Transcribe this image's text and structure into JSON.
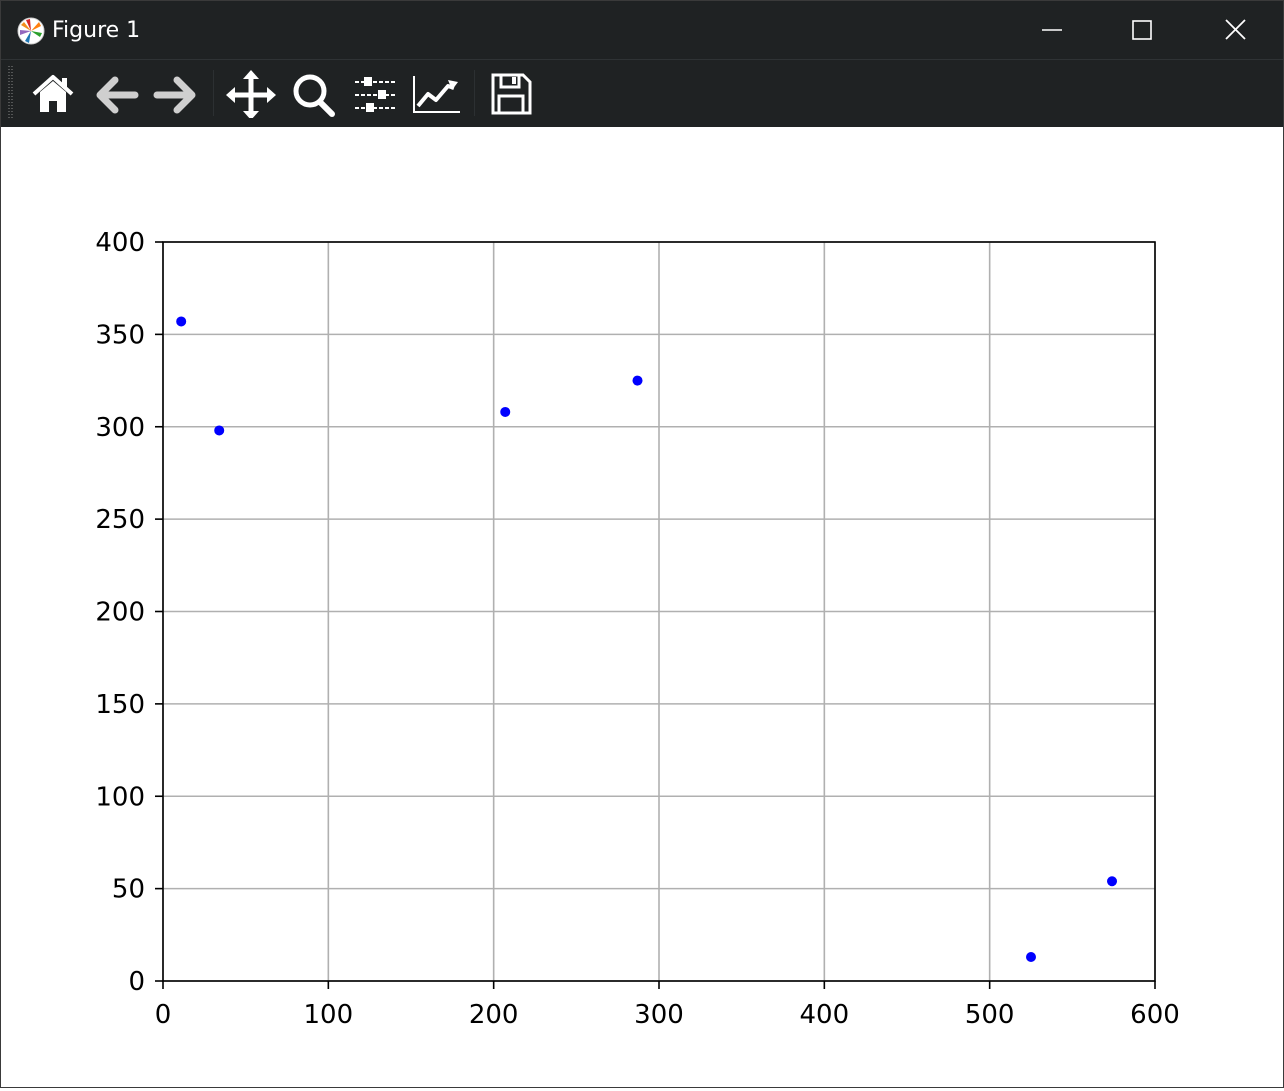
{
  "window": {
    "title": "Figure 1",
    "controls": [
      "minimize-icon",
      "maximize-icon",
      "close-icon"
    ]
  },
  "toolbar": {
    "buttons": [
      {
        "name": "home-icon",
        "label": "Home"
      },
      {
        "name": "back-icon",
        "label": "Back"
      },
      {
        "name": "forward-icon",
        "label": "Forward"
      },
      {
        "name": "pan-icon",
        "label": "Pan"
      },
      {
        "name": "zoom-icon",
        "label": "Zoom"
      },
      {
        "name": "subplots-icon",
        "label": "Subplots"
      },
      {
        "name": "customize-icon",
        "label": "Customize"
      },
      {
        "name": "save-icon",
        "label": "Save"
      }
    ]
  },
  "chart_data": {
    "type": "scatter",
    "title": "",
    "xlabel": "",
    "ylabel": "",
    "xlim": [
      0,
      600
    ],
    "ylim": [
      0,
      400
    ],
    "xticks": [
      0,
      100,
      200,
      300,
      400,
      500,
      600
    ],
    "yticks": [
      0,
      50,
      100,
      150,
      200,
      250,
      300,
      350,
      400
    ],
    "grid": true,
    "marker_color": "#0000ff",
    "points": [
      {
        "x": 11,
        "y": 357
      },
      {
        "x": 34,
        "y": 298
      },
      {
        "x": 207,
        "y": 308
      },
      {
        "x": 287,
        "y": 325
      },
      {
        "x": 525,
        "y": 13
      },
      {
        "x": 574,
        "y": 54
      }
    ]
  }
}
